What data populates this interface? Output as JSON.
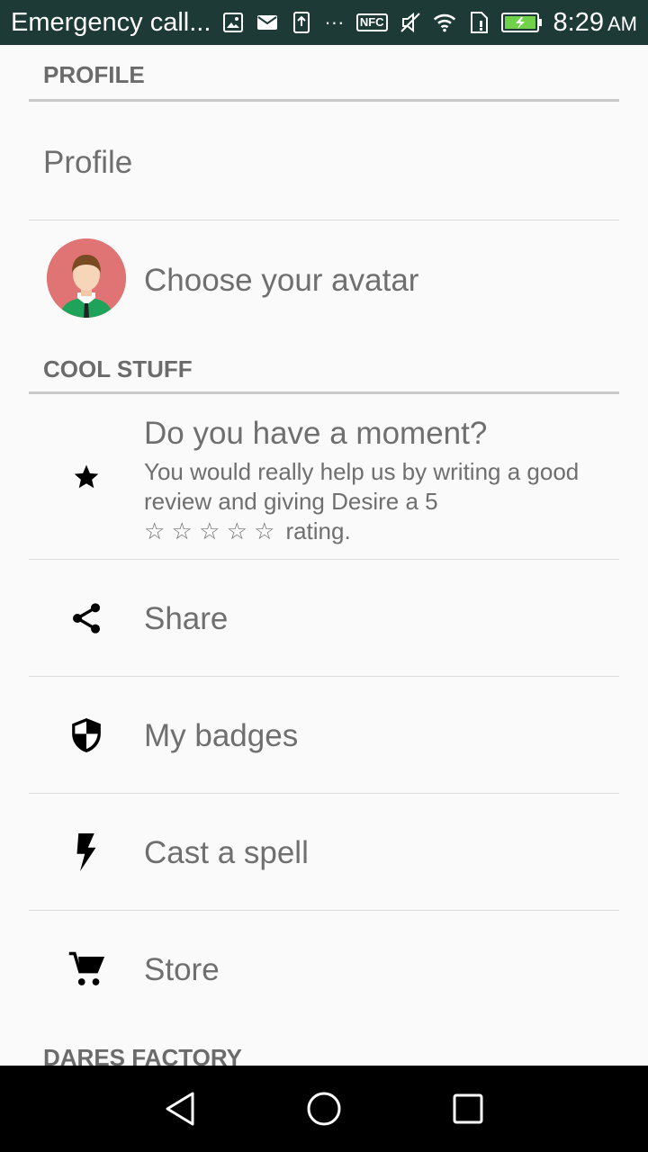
{
  "status_bar": {
    "title": "Emergency call...",
    "overflow": "···",
    "nfc": "NFC",
    "time": "8:29",
    "ampm": "AM",
    "icons": [
      "gallery-icon",
      "mail-icon",
      "upload-icon",
      "nfc-icon",
      "mute-icon",
      "wifi-icon",
      "sim-icon",
      "battery-icon"
    ]
  },
  "sections": {
    "profile_header": "PROFILE",
    "cool_stuff_header": "COOL STUFF",
    "dares_header": "DARES FACTORY"
  },
  "items": {
    "profile": "Profile",
    "avatar": "Choose your avatar",
    "review_title": "Do you have a moment?",
    "review_body": "You would really help us by writing a good review and giving Desire a 5",
    "review_stars": "☆ ☆ ☆ ☆ ☆",
    "review_suffix": "rating.",
    "share": "Share",
    "badges": "My badges",
    "spell": "Cast a spell",
    "store": "Store"
  },
  "colors": {
    "status_bar": "#1d3a36",
    "background": "#fafafa",
    "text": "#6f6f6f",
    "avatar_bg": "#e07474"
  }
}
